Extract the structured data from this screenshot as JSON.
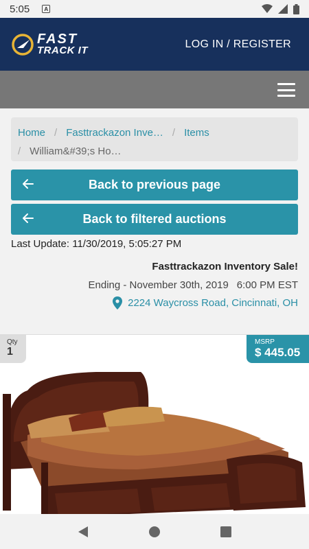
{
  "status_bar": {
    "time": "5:05",
    "notif_glyph": "A"
  },
  "header": {
    "logo_line1": "FAST",
    "logo_line2": "TRACK IT",
    "login_label": "LOG IN / REGISTER",
    "bg_color": "#17305c"
  },
  "breadcrumb": {
    "home": "Home",
    "auction": "Fasttrackazon Inve…",
    "items": "Items",
    "current": "William&#39;s Ho…"
  },
  "buttons": {
    "back_previous": "Back to previous page",
    "back_filtered": "Back to filtered auctions",
    "accent": "#2a93a8"
  },
  "auction": {
    "last_update": "Last Update: 11/30/2019, 5:05:27 PM",
    "title": "Fasttrackazon Inventory Sale!",
    "ending": "Ending - November 30th, 2019",
    "ending_time": "6:00 PM EST",
    "address": "2224 Waycross Road, Cincinnati, OH"
  },
  "item": {
    "qty_label": "Qty",
    "qty_value": "1",
    "msrp_label": "MSRP",
    "msrp_value": "$ 445.05"
  },
  "icons": [
    "wifi-icon",
    "signal-icon",
    "battery-icon",
    "menu-icon",
    "arrow-left-icon",
    "location-pin-icon",
    "back-nav-icon",
    "home-nav-icon",
    "recents-nav-icon"
  ]
}
